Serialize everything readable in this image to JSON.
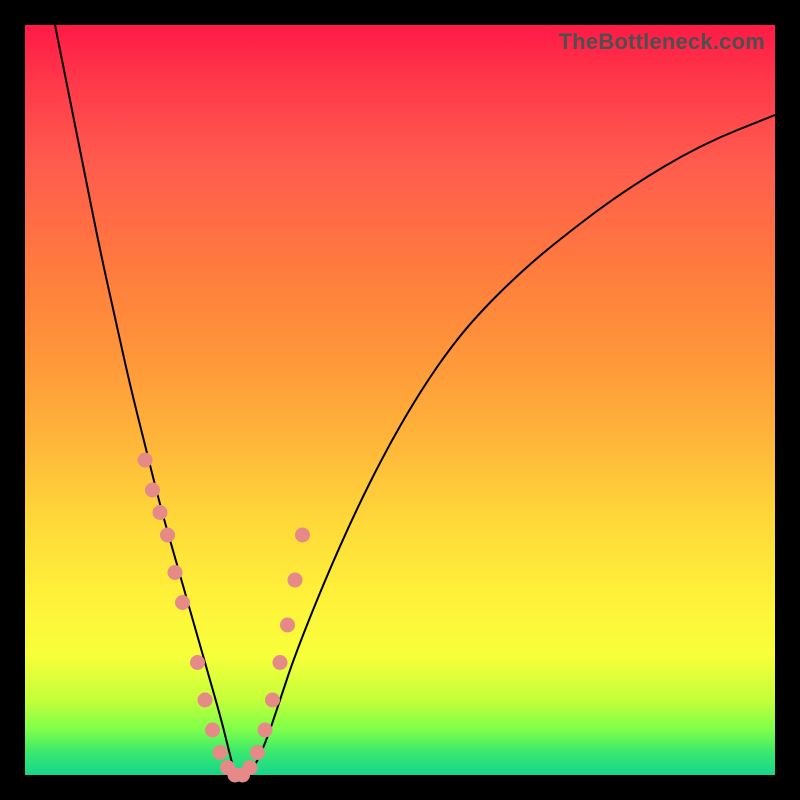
{
  "watermark": "TheBottleneck.com",
  "colors": {
    "background_frame": "#000000",
    "gradient_top": "#ff1a46",
    "gradient_mid": "#ffd839",
    "gradient_bottom": "#16d68d",
    "curve": "#000000",
    "markers": "#e58a87"
  },
  "chart_data": {
    "type": "line",
    "title": "",
    "xlabel": "",
    "ylabel": "",
    "xlim": [
      0,
      100
    ],
    "ylim": [
      0,
      100
    ],
    "grid": false,
    "series": [
      {
        "name": "bottleneck-curve",
        "x": [
          4,
          6,
          8,
          10,
          12,
          14,
          16,
          18,
          20,
          22,
          24,
          26,
          27,
          28,
          30,
          32,
          34,
          36,
          40,
          44,
          48,
          52,
          56,
          60,
          66,
          72,
          80,
          90,
          100
        ],
        "y": [
          100,
          90,
          80,
          70,
          61,
          52,
          44,
          36,
          29,
          22,
          15,
          8,
          4,
          0,
          0,
          4,
          10,
          16,
          26,
          35,
          43,
          50,
          56,
          61,
          67,
          72,
          78,
          84,
          88
        ]
      }
    ],
    "annotations": [],
    "markers": {
      "name": "highlighted-points",
      "x": [
        16,
        17,
        18,
        19,
        20,
        21,
        23,
        24,
        25,
        26,
        27,
        28,
        29,
        30,
        31,
        32,
        33,
        34,
        35,
        36,
        37
      ],
      "y": [
        42,
        38,
        35,
        32,
        27,
        23,
        15,
        10,
        6,
        3,
        1,
        0,
        0,
        1,
        3,
        6,
        10,
        15,
        20,
        26,
        32
      ]
    },
    "legend": false
  }
}
